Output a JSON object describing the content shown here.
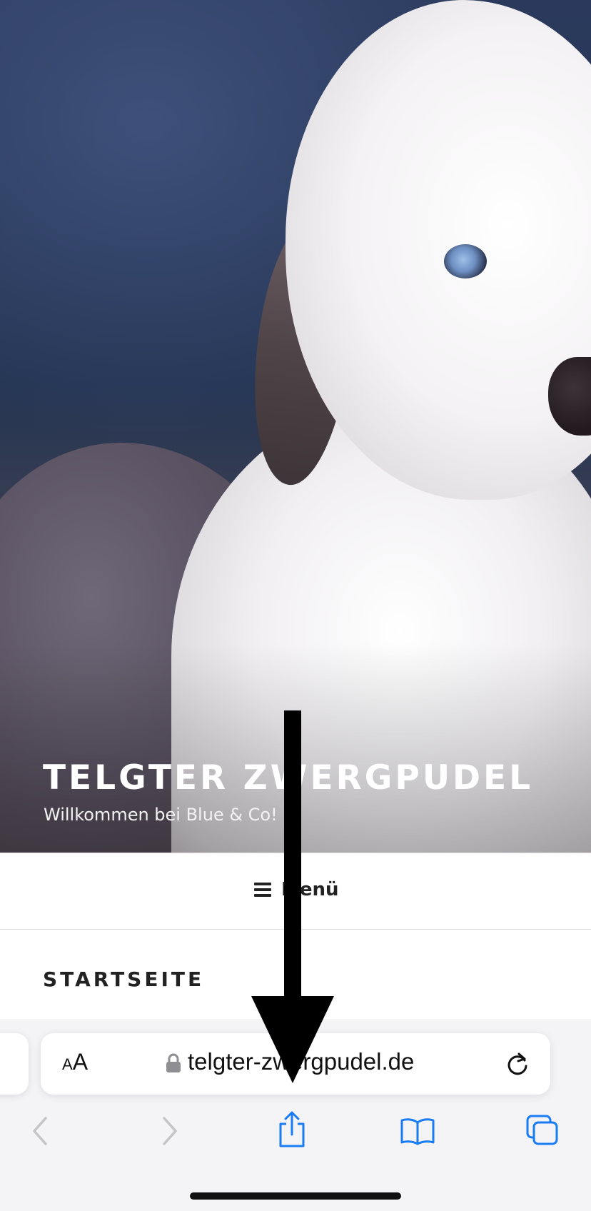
{
  "site": {
    "title": "TELGTER ZWERGPUDEL",
    "tagline": "Willkommen bei Blue & Co!"
  },
  "nav": {
    "menu_label": "Menü",
    "menu_icon": "hamburger-icon"
  },
  "page": {
    "heading": "STARTSEITE"
  },
  "browser": {
    "text_size_button_small": "A",
    "text_size_button_large": "A",
    "url": "telgter-zwergpudel.de",
    "lock_icon": "lock-icon",
    "reload_icon": "reload-icon",
    "toolbar": [
      {
        "name": "back",
        "icon": "chevron-left-icon",
        "enabled": false
      },
      {
        "name": "forward",
        "icon": "chevron-right-icon",
        "enabled": false
      },
      {
        "name": "share",
        "icon": "share-icon",
        "enabled": true
      },
      {
        "name": "bookmarks",
        "icon": "book-icon",
        "enabled": true
      },
      {
        "name": "tabs",
        "icon": "tabs-icon",
        "enabled": true
      }
    ],
    "accent_color": "#1a7cf5",
    "disabled_color": "#c4c4c9"
  },
  "annotation": {
    "arrow_icon": "down-arrow-icon",
    "color": "#000000"
  }
}
